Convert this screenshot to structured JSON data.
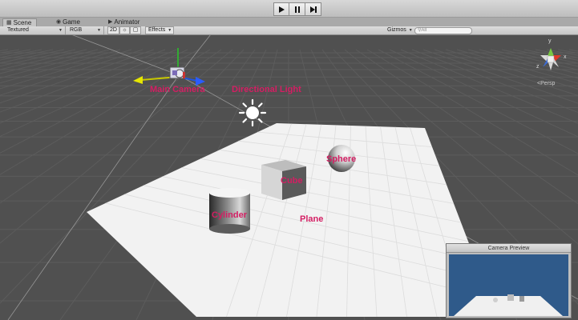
{
  "toolbar": {
    "play_icon": "play-icon",
    "pause_icon": "pause-icon",
    "step_icon": "step-icon"
  },
  "tabs": [
    {
      "label": "Scene",
      "icon": "scene-icon",
      "active": true
    },
    {
      "label": "Game",
      "icon": "game-icon",
      "active": false
    },
    {
      "label": "Animator",
      "icon": "animator-icon",
      "active": false
    }
  ],
  "scene_toolbar": {
    "draw_mode": "Textured",
    "render_mode": "RGB",
    "mode_2d": "2D",
    "effects": "Effects",
    "gizmos": "Gizmos",
    "search_placeholder": "All"
  },
  "gizmo": {
    "projection": "Persp",
    "axis_y": "y",
    "axis_x": "x",
    "axis_z": "z"
  },
  "scene_objects": {
    "main_camera": "Main Camera",
    "directional_light": "Directional Light",
    "sphere": "Sphere",
    "cube": "Cube",
    "cylinder": "Cylinder",
    "plane": "Plane"
  },
  "camera_preview": {
    "title": "Camera Preview"
  },
  "colors": {
    "label": "#d41e63",
    "viewport_bg": "#505050",
    "grid": "#5c5c5c",
    "plane": "#f2f2f2",
    "preview_bg": "#2f5a8a"
  }
}
